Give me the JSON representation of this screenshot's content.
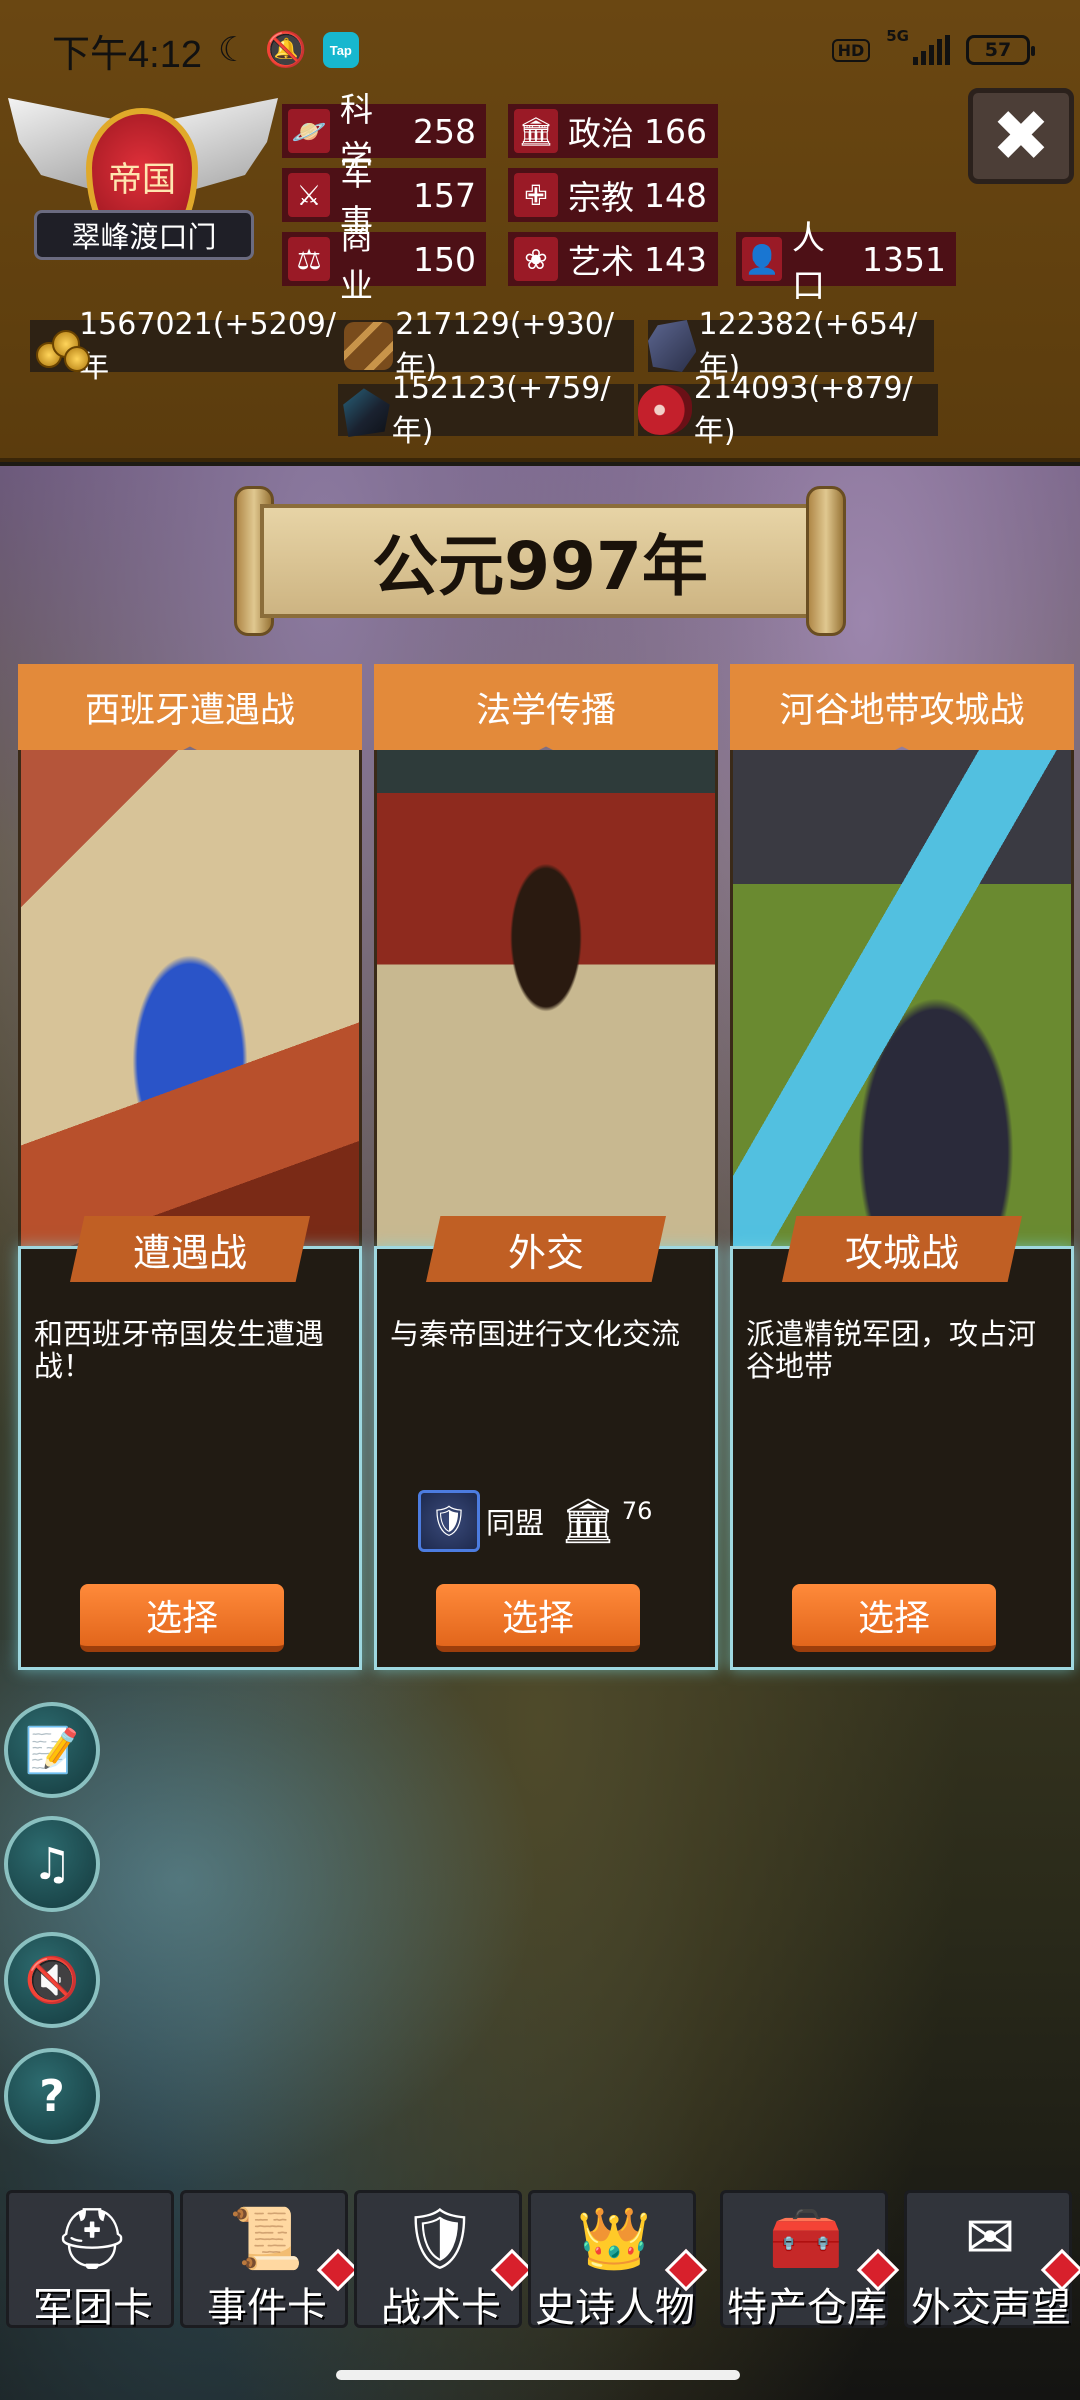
{
  "status_bar": {
    "time": "下午4:12",
    "tap_label": "Tap",
    "hd_label": "HD",
    "network": "5G",
    "battery": "57"
  },
  "emblem": {
    "title": "帝国",
    "name": "翠峰渡口门"
  },
  "stats": {
    "science": {
      "label": "科学",
      "value": "258"
    },
    "politics": {
      "label": "政治",
      "value": "166"
    },
    "military": {
      "label": "军事",
      "value": "157"
    },
    "religion": {
      "label": "宗教",
      "value": "148"
    },
    "commerce": {
      "label": "商业",
      "value": "150"
    },
    "art": {
      "label": "艺术",
      "value": "143"
    },
    "population": {
      "label": "人口",
      "value": "1351"
    }
  },
  "resources": {
    "gold": "1567021(+5209/年",
    "wood": "217129(+930/年)",
    "stone": "122382(+654/年)",
    "iron": "152123(+759/年)",
    "meat": "214093(+879/年)"
  },
  "year": "公元997年",
  "cards": [
    {
      "title": "西班牙遭遇战",
      "type": "遭遇战",
      "desc": "和西班牙帝国发生遭遇战！",
      "button": "选择"
    },
    {
      "title": "法学传播",
      "type": "外交",
      "desc": "与秦帝国进行文化交流",
      "req_label": "同盟",
      "req_value": "76",
      "button": "选择"
    },
    {
      "title": "河谷地带攻城战",
      "type": "攻城战",
      "desc": "派遣精锐军团，攻占河谷地带",
      "button": "选择"
    }
  ],
  "nav": [
    {
      "label": "军团卡",
      "icon": "helmet-icon"
    },
    {
      "label": "事件卡",
      "icon": "scroll-icon"
    },
    {
      "label": "战术卡",
      "icon": "shield-swords-icon"
    },
    {
      "label": "史诗人物",
      "icon": "crown-icon"
    },
    {
      "label": "特产仓库",
      "icon": "chest-icon"
    },
    {
      "label": "外交声望",
      "icon": "letter-icon"
    }
  ],
  "colors": {
    "header_bg": "#6a4712",
    "stat_bg": "#4d1016",
    "card_orange": "#e38a3a",
    "button_orange": "#ff8a3a",
    "card_border": "#9fd8e0"
  }
}
